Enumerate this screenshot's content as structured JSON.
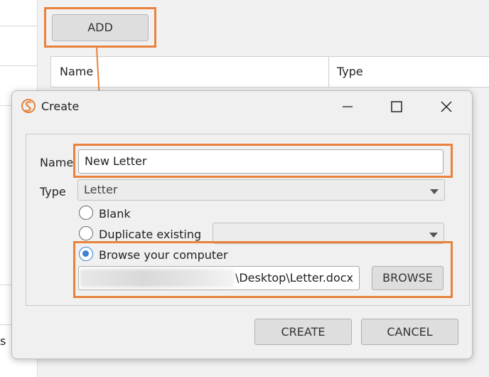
{
  "background": {
    "add_button": "ADD",
    "columns": [
      "Name",
      "Type"
    ],
    "side_text": "s"
  },
  "dialog": {
    "title": "Create",
    "name_label": "Name",
    "name_value": "New Letter",
    "type_label": "Type",
    "type_value": "Letter",
    "options": {
      "blank": "Blank",
      "duplicate": "Duplicate existing",
      "browse": "Browse your computer"
    },
    "selected_option": "browse",
    "file_path": "\\Desktop\\Letter.docx",
    "browse_button": "BROWSE",
    "create_button": "CREATE",
    "cancel_button": "CANCEL"
  },
  "colors": {
    "highlight": "#e8823c",
    "radio_selected": "#3b82d6"
  }
}
